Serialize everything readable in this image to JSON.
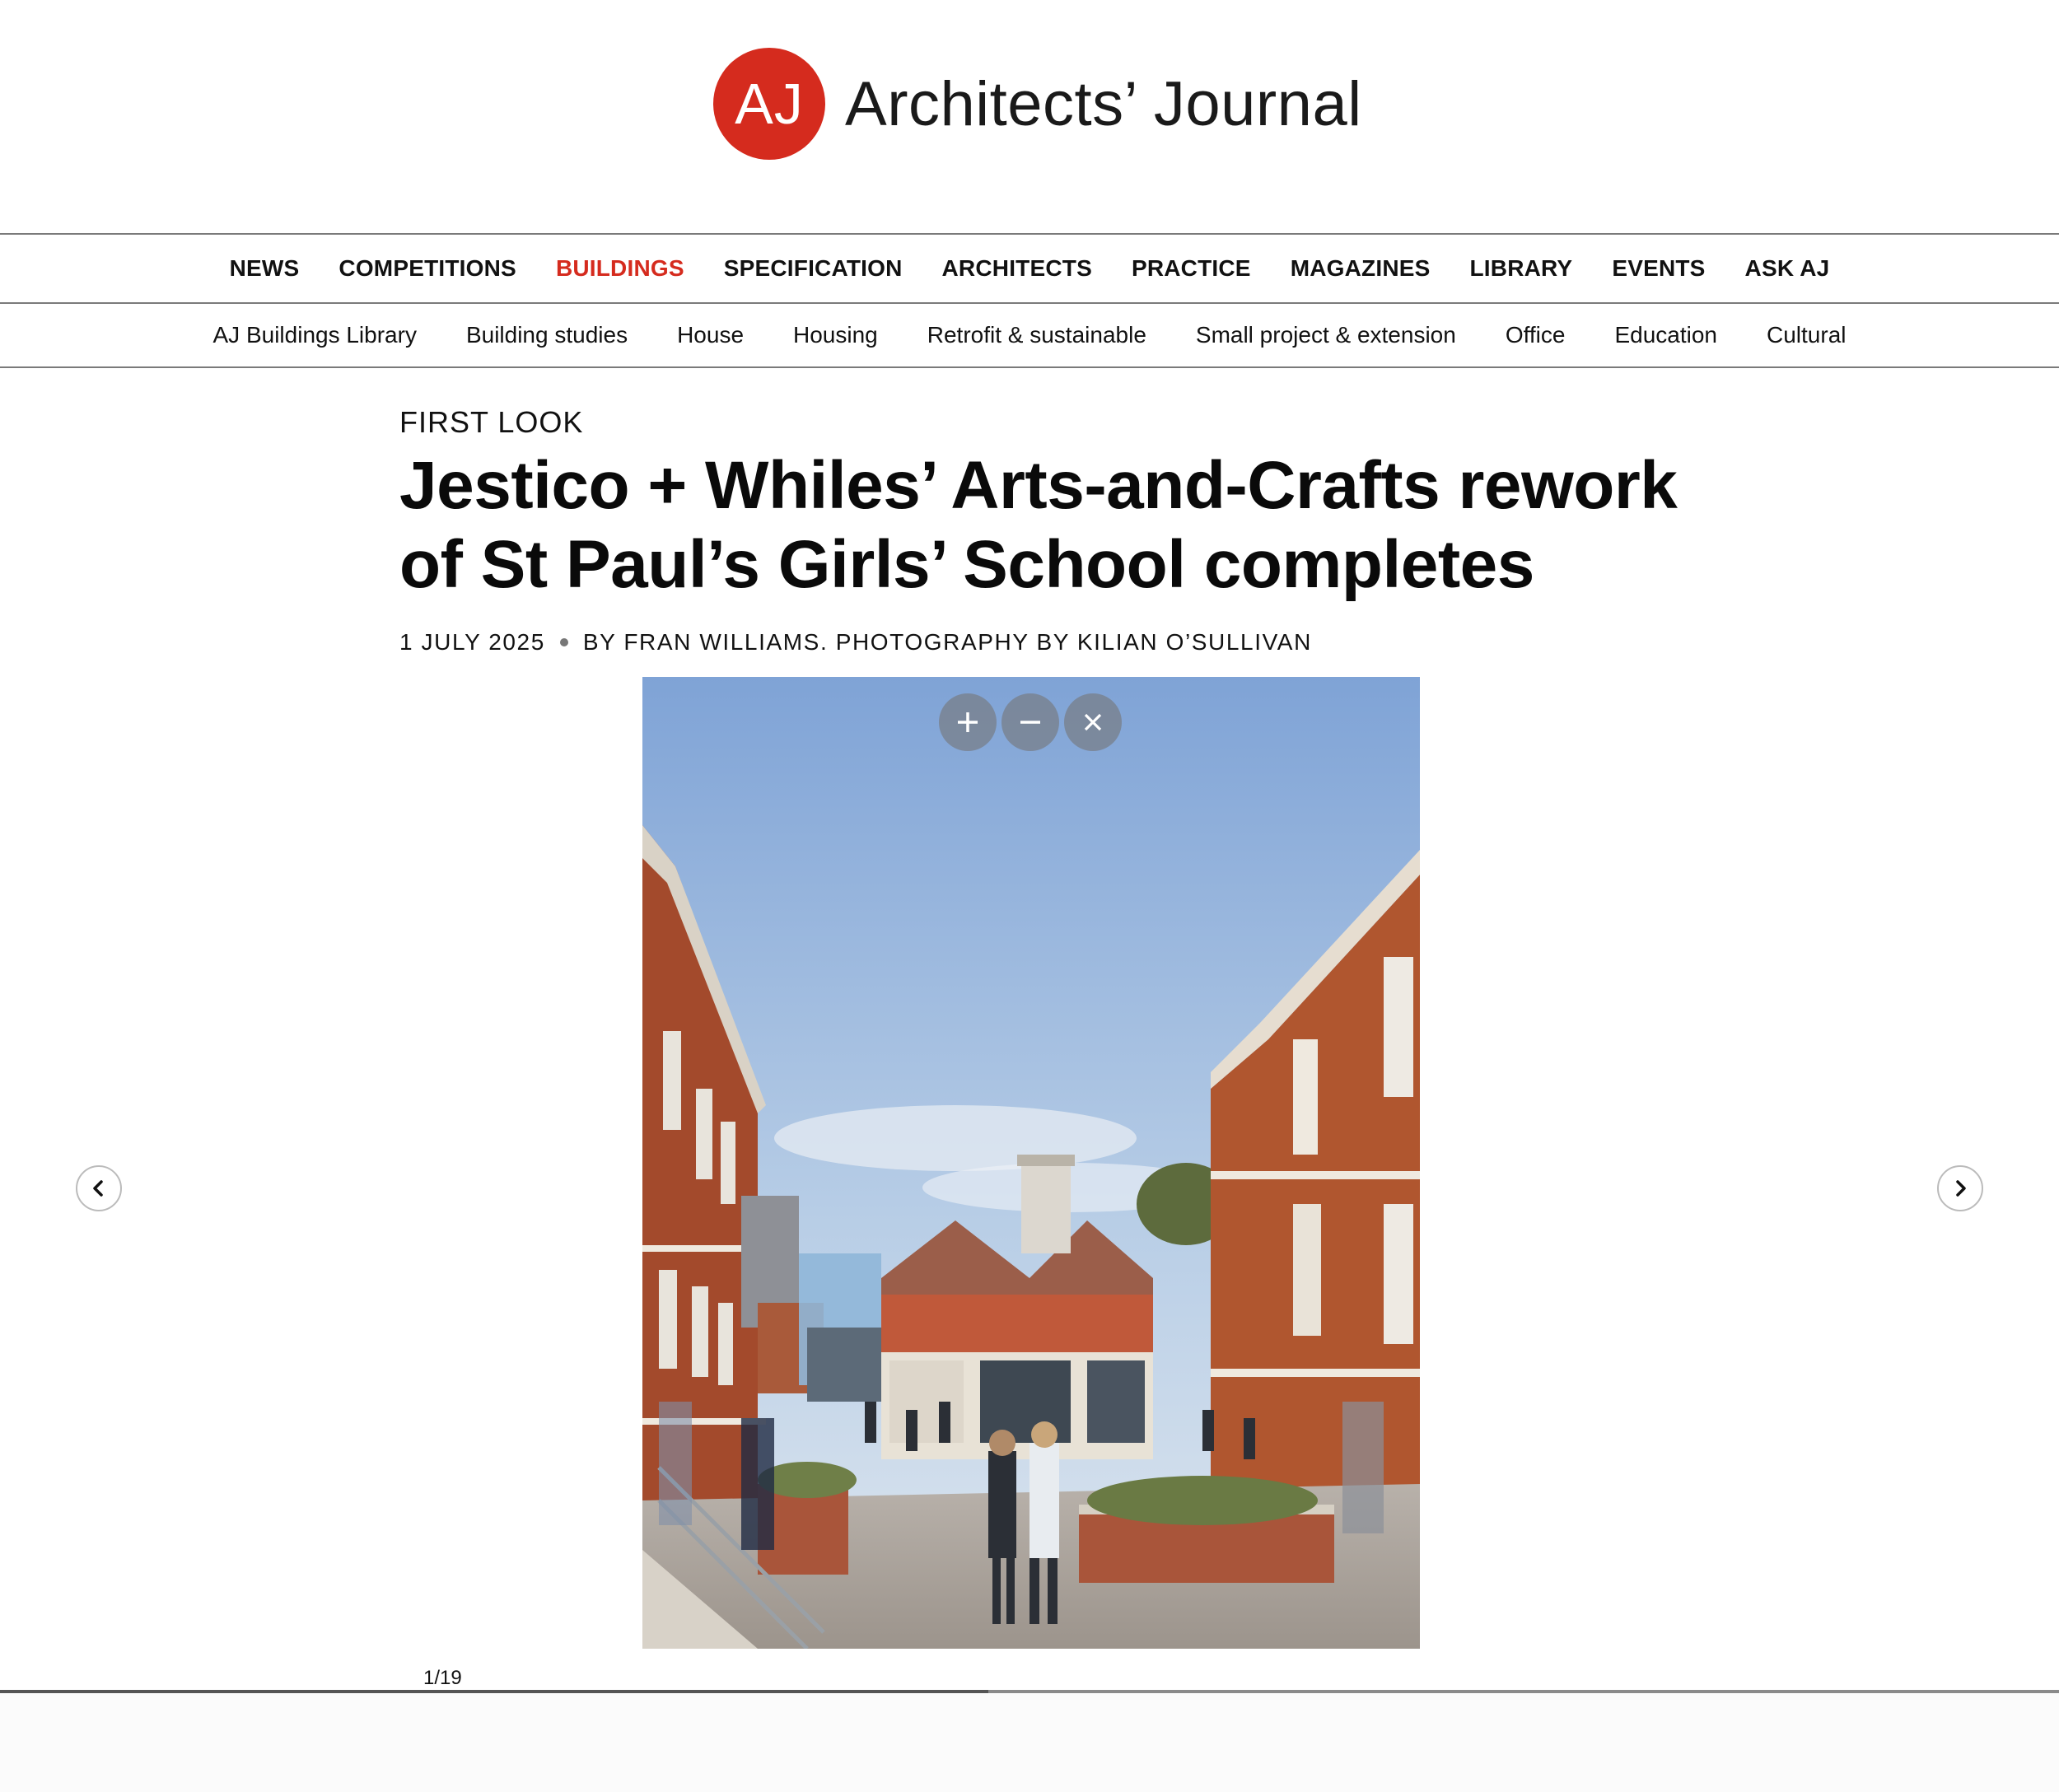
{
  "site": {
    "logo_initials": "AJ",
    "name": "Architects’ Journal",
    "brand_color": "#d52b1e"
  },
  "primary_nav": [
    {
      "label": "NEWS",
      "active": false
    },
    {
      "label": "COMPETITIONS",
      "active": false
    },
    {
      "label": "BUILDINGS",
      "active": true
    },
    {
      "label": "SPECIFICATION",
      "active": false
    },
    {
      "label": "ARCHITECTS",
      "active": false
    },
    {
      "label": "PRACTICE",
      "active": false
    },
    {
      "label": "MAGAZINES",
      "active": false
    },
    {
      "label": "LIBRARY",
      "active": false
    },
    {
      "label": "EVENTS",
      "active": false
    },
    {
      "label": "ASK AJ",
      "active": false
    }
  ],
  "secondary_nav": [
    {
      "label": "AJ Buildings Library"
    },
    {
      "label": "Building studies"
    },
    {
      "label": "House"
    },
    {
      "label": "Housing"
    },
    {
      "label": "Retrofit & sustainable"
    },
    {
      "label": "Small project & extension"
    },
    {
      "label": "Office"
    },
    {
      "label": "Education"
    },
    {
      "label": "Cultural"
    }
  ],
  "article": {
    "kicker": "FIRST LOOK",
    "headline_line1": "Jestico + Whiles’ Arts-and-Crafts rework",
    "headline_line2": "of St Paul’s Girls’ School completes",
    "date": "1 JULY 2025",
    "byline": "BY FRAN WILLIAMS. PHOTOGRAPHY BY KILIAN O’SULLIVAN"
  },
  "gallery": {
    "counter": "1/19",
    "progress": 0.48,
    "zoom_in_icon": "plus-icon",
    "zoom_out_icon": "minus-icon",
    "close_icon": "close-icon",
    "prev_icon": "chevron-left-icon",
    "next_icon": "chevron-right-icon"
  }
}
